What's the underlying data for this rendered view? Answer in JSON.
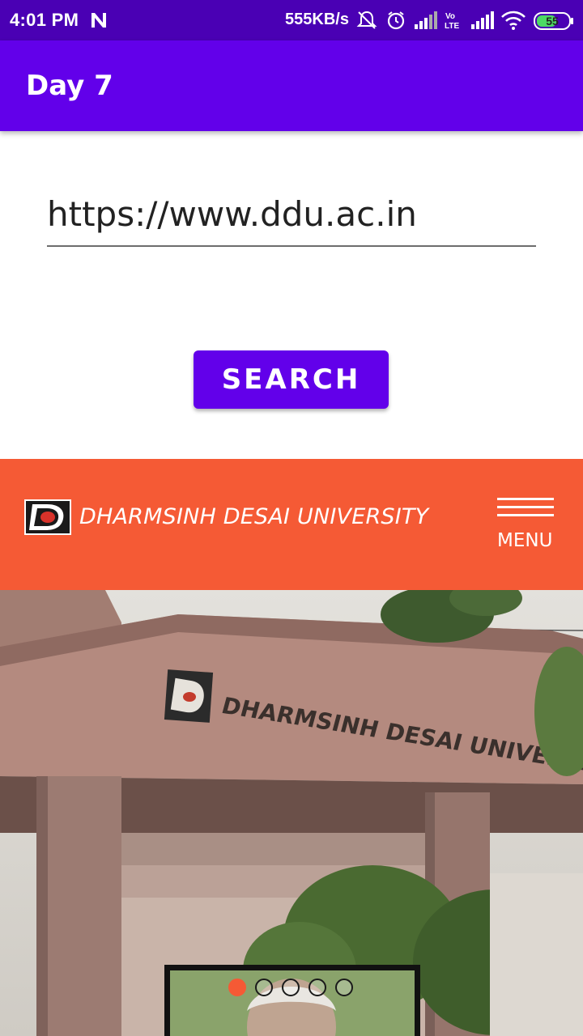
{
  "status_bar": {
    "time": "4:01 PM",
    "network_speed": "555KB/s",
    "battery": "55",
    "icons": [
      "n-notification-icon",
      "mute-bell-icon",
      "alarm-icon",
      "signal-icon",
      "volte-icon",
      "signal-icon",
      "wifi-icon",
      "battery-icon"
    ]
  },
  "app_bar": {
    "title": "Day 7"
  },
  "url_input": {
    "value": "https://www.ddu.ac.in"
  },
  "search_button": {
    "label": "SEARCH"
  },
  "website": {
    "header": {
      "university_name": "DHARMSINH DESAI UNIVERSITY",
      "menu_label": "MENU",
      "logo_letter": "D"
    },
    "hero": {
      "building_sign_text": "DHARMSINH DESAI UNIVERSITY",
      "carousel": {
        "slide_count": 5,
        "active_slide": 1
      }
    }
  },
  "colors": {
    "status_bar": "#4a00b4",
    "app_bar": "#6200ea",
    "button": "#6200ea",
    "site_header": "#f55a35"
  }
}
